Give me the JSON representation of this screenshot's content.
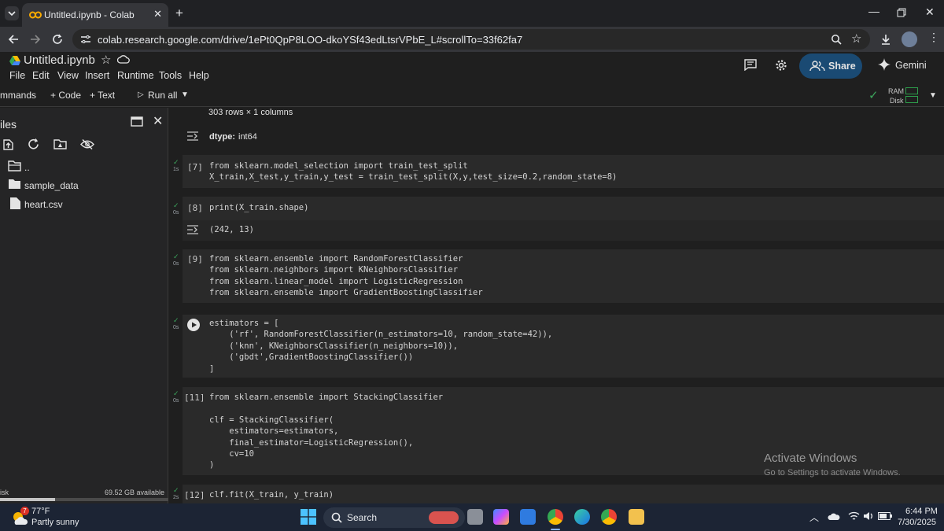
{
  "browser": {
    "tab_title": "Untitled.ipynb - Colab",
    "url": "colab.research.google.com/drive/1ePt0QpP8LOO-dkoYSf43edLtsrVPbE_L#scrollTo=33f62fa7"
  },
  "colab": {
    "notebook_name": "Untitled.ipynb",
    "menu": [
      "File",
      "Edit",
      "View",
      "Insert",
      "Runtime",
      "Tools",
      "Help"
    ],
    "share_label": "Share",
    "gemini_label": "Gemini"
  },
  "toolbar": {
    "commands": "mmands",
    "code": "+ Code",
    "text": "+ Text",
    "run_all": "Run all",
    "ram": "RAM",
    "disk": "Disk"
  },
  "sidebar": {
    "title": "iles",
    "items": [
      "..",
      "sample_data",
      "heart.csv"
    ],
    "disk_label": "isk",
    "disk_available": "69.52 GB available"
  },
  "notebook": {
    "out_rows": "303 rows × 1 columns",
    "out_dtype_label": "dtype:",
    "out_dtype_value": "int64",
    "cells": [
      {
        "prompt": "[7]",
        "time": "1s",
        "code": "from sklearn.model_selection import train_test_split\nX_train,X_test,y_train,y_test = train_test_split(X,y,test_size=0.2,random_state=8)"
      },
      {
        "prompt": "[8]",
        "time": "0s",
        "code": "print(X_train.shape)"
      },
      {
        "prompt": "[9]",
        "time": "0s",
        "code": "from sklearn.ensemble import RandomForestClassifier\nfrom sklearn.neighbors import KNeighborsClassifier\nfrom sklearn.linear_model import LogisticRegression\nfrom sklearn.ensemble import GradientBoostingClassifier"
      },
      {
        "prompt": "",
        "time": "0s",
        "code": "estimators = [\n    ('rf', RandomForestClassifier(n_estimators=10, random_state=42)),\n    ('knn', KNeighborsClassifier(n_neighbors=10)),\n    ('gbdt',GradientBoostingClassifier())\n]"
      },
      {
        "prompt": "[11]",
        "time": "0s",
        "code": "from sklearn.ensemble import StackingClassifier\n\nclf = StackingClassifier(\n    estimators=estimators,\n    final_estimator=LogisticRegression(),\n    cv=10\n)"
      },
      {
        "prompt": "[12]",
        "time": "2s",
        "code": "clf.fit(X_train, y_train)"
      }
    ],
    "out8": "(242, 13)"
  },
  "watermark": {
    "line1": "Activate Windows",
    "line2": "Go to Settings to activate Windows."
  },
  "taskbar": {
    "temp": "77°F",
    "weather": "Partly sunny",
    "weather_badge": "7",
    "search": "Search",
    "time": "6:44 PM",
    "date": "7/30/2025"
  }
}
